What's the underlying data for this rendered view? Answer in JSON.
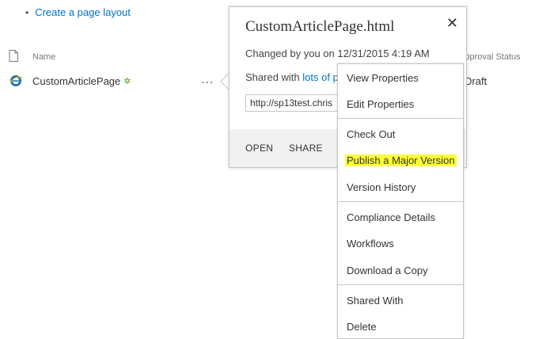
{
  "page": {
    "create_layout_link": "Create a page layout"
  },
  "list": {
    "columns": {
      "name": "Name",
      "approval_status": "Approval Status"
    },
    "row": {
      "name": "CustomArticlePage",
      "ellipsis": "...",
      "status": "Draft"
    }
  },
  "callout": {
    "title": "CustomArticlePage.html",
    "close_glyph": "✕",
    "changed_text": "Changed by you on 12/31/2015 4:19 AM",
    "shared_prefix": "Shared with ",
    "shared_link": "lots of p",
    "url": "http://sp13test.chris",
    "actions": {
      "open": "OPEN",
      "share": "SHARE"
    }
  },
  "menu": {
    "items": [
      {
        "label": "View Properties"
      },
      {
        "label": "Edit Properties"
      },
      {
        "label": "Check Out"
      },
      {
        "label": "Publish a Major Version",
        "highlighted": true
      },
      {
        "label": "Version History"
      },
      {
        "label": "Compliance Details"
      },
      {
        "label": "Workflows"
      },
      {
        "label": "Download a Copy"
      },
      {
        "label": "Shared With"
      },
      {
        "label": "Delete"
      }
    ]
  },
  "colors": {
    "link": "#0072c6",
    "highlight": "#ffff38",
    "border": "#c6c6c6",
    "footer": "#f1f1f1"
  },
  "icons": {
    "document_header": "document-icon",
    "row_file": "ie-html-file-icon",
    "new_item": "new-item-icon",
    "close": "close-icon"
  }
}
